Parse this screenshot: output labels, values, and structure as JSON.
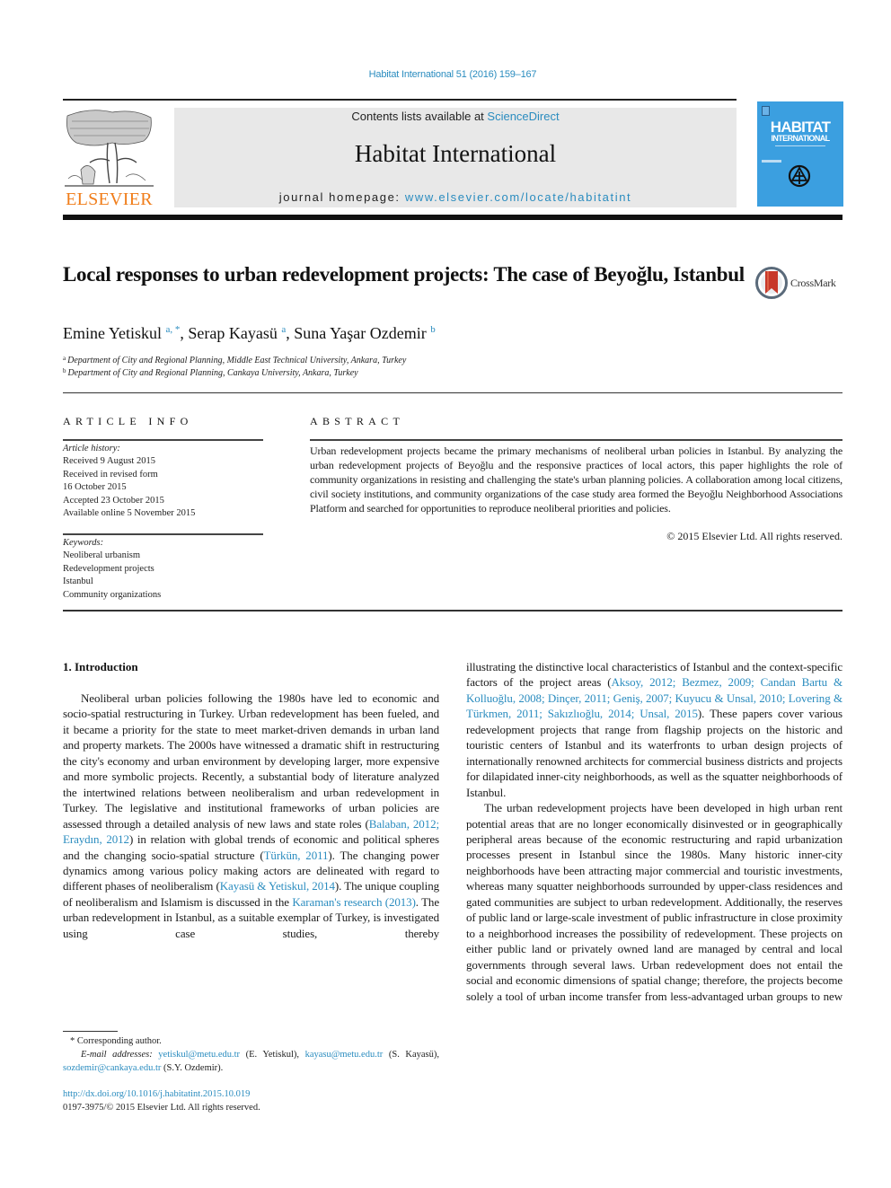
{
  "header": {
    "citation": "Habitat International 51 (2016) 159–167",
    "publisher_logo_text": "ELSEVIER",
    "contents_prefix": "Contents lists available at ",
    "contents_link": "ScienceDirect",
    "journal_name": "Habitat International",
    "homepage_prefix": "journal homepage: ",
    "homepage_link": "www.elsevier.com/locate/habitatint",
    "cover": {
      "title_line1": "HABITAT",
      "title_line2": "INTERNATIONAL",
      "background_color": "#3b9fe0"
    },
    "brand_color": "#f07d1a",
    "link_color": "#2a8cbf"
  },
  "article": {
    "title": "Local responses to urban redevelopment projects: The case of Beyoğlu, Istanbul",
    "crossmark_label": "CrossMark",
    "authors": [
      {
        "name": "Emine Yetiskul",
        "marks": "a, *"
      },
      {
        "name": "Serap Kayasü",
        "marks": "a"
      },
      {
        "name": "Suna Yaşar Ozdemir",
        "marks": "b"
      }
    ],
    "affiliations": [
      {
        "mark": "a",
        "text": "Department of City and Regional Planning, Middle East Technical University, Ankara, Turkey"
      },
      {
        "mark": "b",
        "text": "Department of City and Regional Planning, Cankaya University, Ankara, Turkey"
      }
    ]
  },
  "article_info": {
    "heading": "ARTICLE INFO",
    "history_label": "Article history:",
    "history": [
      "Received 9 August 2015",
      "Received in revised form",
      "16 October 2015",
      "Accepted 23 October 2015",
      "Available online 5 November 2015"
    ],
    "keywords_label": "Keywords:",
    "keywords": [
      "Neoliberal urbanism",
      "Redevelopment projects",
      "Istanbul",
      "Community organizations"
    ]
  },
  "abstract": {
    "heading": "ABSTRACT",
    "text": "Urban redevelopment projects became the primary mechanisms of neoliberal urban policies in Istanbul. By analyzing the urban redevelopment projects of Beyoğlu and the responsive practices of local actors, this paper highlights the role of community organizations in resisting and challenging the state's urban planning policies. A collaboration among local citizens, civil society institutions, and community organizations of the case study area formed the Beyoğlu Neighborhood Associations Platform and searched for opportunities to reproduce neoliberal priorities and policies.",
    "copyright": "© 2015 Elsevier Ltd. All rights reserved."
  },
  "body": {
    "section_heading": "1.  Introduction",
    "left_para": [
      {
        "t": "Neoliberal urban policies following the 1980s have led to economic and socio-spatial restructuring in Turkey. Urban redevelopment has been fueled, and it became a priority for the state to meet market-driven demands in urban land and property markets. The 2000s have witnessed a dramatic shift in restructuring the city's economy and urban environment by developing larger, more expensive and more symbolic projects. Recently, a substantial body of literature analyzed the intertwined relations between neoliberalism and urban redevelopment in Turkey. The legislative and institutional frameworks of urban policies are assessed through a detailed analysis of new laws and state roles ("
      },
      {
        "link": "Balaban, 2012; Eraydın, 2012"
      },
      {
        "t": ") in relation with global trends of economic and political spheres and the changing socio-spatial structure ("
      },
      {
        "link": "Türkün, 2011"
      },
      {
        "t": "). The changing power dynamics among various policy making actors are delineated with regard to different phases of neoliberalism ("
      },
      {
        "link": "Kayasü & Yetiskul, 2014"
      },
      {
        "t": "). The unique coupling of neoliberalism and Islamism is discussed in the "
      },
      {
        "link": "Karaman's research (2013)"
      },
      {
        "t": ". The urban redevelopment in Istanbul, as a suitable exemplar of Turkey, is investigated using case studies, thereby"
      }
    ],
    "right_para1": [
      {
        "t": "illustrating the distinctive local characteristics of Istanbul and the context-specific factors of the project areas ("
      },
      {
        "link": "Aksoy, 2012; Bezmez, 2009; Candan Bartu & Kolluoğlu, 2008; Dinçer, 2011; Geniş, 2007; Kuyucu & Unsal, 2010; Lovering & Türkmen, 2011; Sakızlıoğlu, 2014; Unsal, 2015"
      },
      {
        "t": "). These papers cover various redevelopment projects that range from flagship projects on the historic and touristic centers of Istanbul and its waterfronts to urban design projects of internationally renowned architects for commercial business districts and projects for dilapidated inner-city neighborhoods, as well as the squatter neighborhoods of Istanbul."
      }
    ],
    "right_para2": "The urban redevelopment projects have been developed in high urban rent potential areas that are no longer economically disinvested or in geographically peripheral areas because of the economic restructuring and rapid urbanization processes present in Istanbul since the 1980s. Many historic inner-city neighborhoods have been attracting major commercial and touristic investments, whereas many squatter neighborhoods surrounded by upper-class residences and gated communities are subject to urban redevelopment. Additionally, the reserves of public land or large-scale investment of public infrastructure in close proximity to a neighborhood increases the possibility of redevelopment. These projects on either public land or privately owned land are managed by central and local governments through several laws. Urban redevelopment does not entail the social and economic dimensions of spatial change; therefore, the projects become solely a tool of urban income transfer from less-advantaged urban groups to new"
  },
  "footnotes": {
    "corresponding": "* Corresponding author.",
    "email_label": "E-mail addresses:",
    "emails": [
      {
        "address": "yetiskul@metu.edu.tr",
        "owner": "(E. Yetiskul),"
      },
      {
        "address": "kayasu@metu.edu.tr",
        "owner": "(S. Kayasü),"
      },
      {
        "address": "sozdemir@cankaya.edu.tr",
        "owner": "(S.Y. Ozdemir)."
      }
    ],
    "doi": "http://dx.doi.org/10.1016/j.habitatint.2015.10.019",
    "issn_copyright": "0197-3975/© 2015 Elsevier Ltd. All rights reserved."
  }
}
